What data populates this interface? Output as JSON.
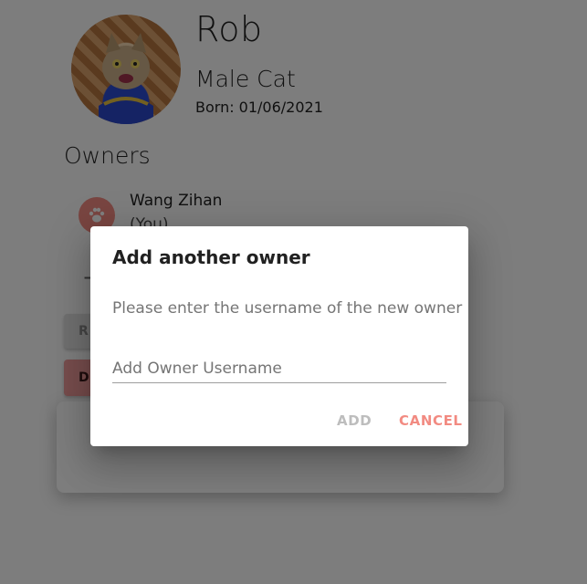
{
  "pet": {
    "name": "Rob",
    "type": "Male Cat",
    "born": "Born: 01/06/2021",
    "avatar_icon": "cat-photo-avatar"
  },
  "owners": {
    "title": "Owners",
    "items": [
      {
        "name": "Wang Zihan",
        "note": "(You)",
        "icon": "paw-icon"
      }
    ],
    "add_symbol": "+"
  },
  "actions": {
    "remove_label": "RE",
    "delete_label": "D"
  },
  "dialog": {
    "title": "Add another owner",
    "text": "Please enter the username of the new owner",
    "input_value": "",
    "input_placeholder": "Add Owner Username",
    "add_label": "ADD",
    "cancel_label": "CANCEL"
  },
  "colors": {
    "accent": "#ef9a9a",
    "cancel": "#f28b82",
    "overlay": "rgba(0,0,0,0.5)"
  }
}
